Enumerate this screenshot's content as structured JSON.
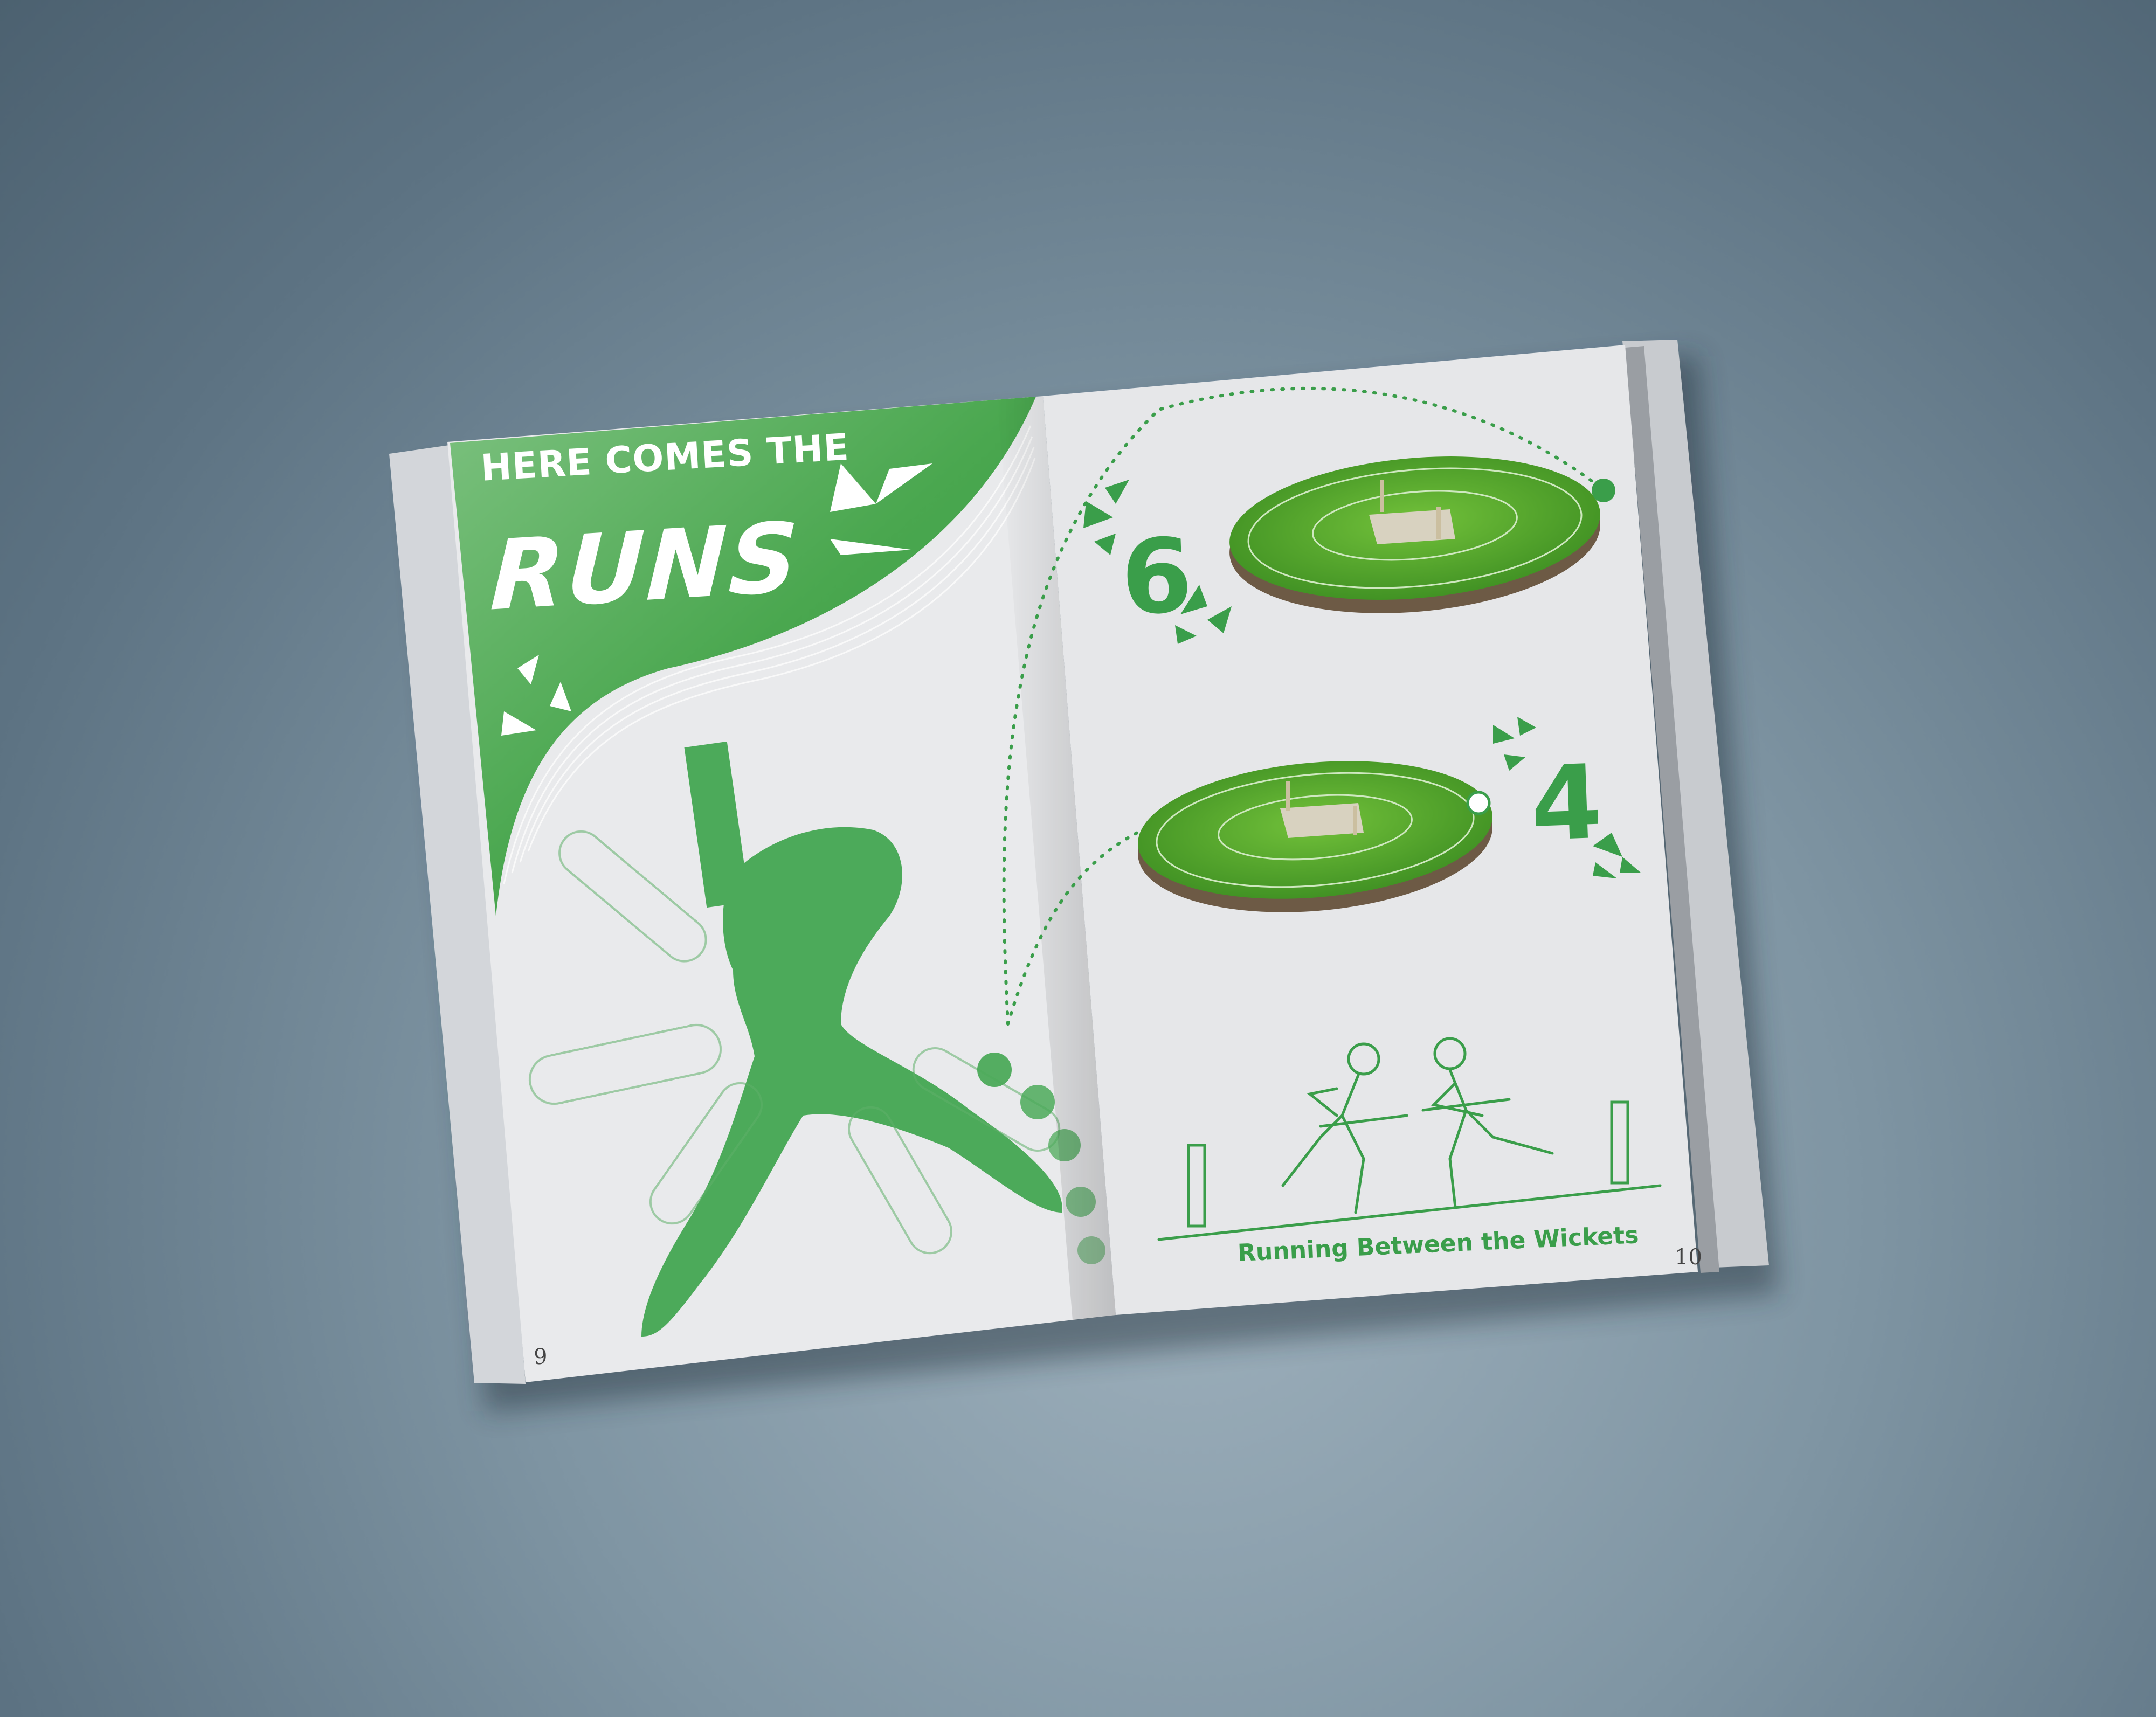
{
  "spread": {
    "left_page": {
      "heading_line1": "HERE COMES THE",
      "heading_line2": "RUNS",
      "page_number": "9"
    },
    "right_page": {
      "six_label": "6",
      "four_label": "4",
      "caption": "Running Between the Wickets",
      "page_number": "10"
    }
  },
  "colors": {
    "background": "#6f8595",
    "page": "#e9eaec",
    "brand_green": "#3a9e4a",
    "light_green": "#7bc483",
    "field_green": "#4fa42e"
  }
}
